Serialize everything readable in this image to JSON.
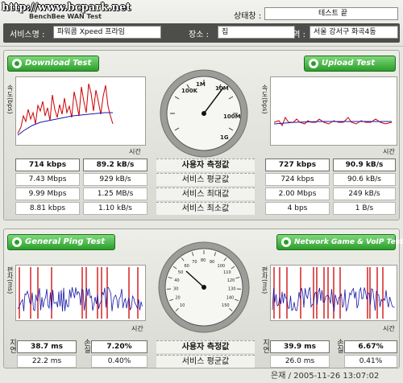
{
  "header": {
    "watermark": "http://www.bcpark.net",
    "brand": "BenchBee WAN Test",
    "status_label": "상태창 :",
    "status_value": "테스트 끝",
    "service_label": "서비스명 :",
    "service_value": "파워콤 Xpeed 프라임",
    "place_label": "장소 :",
    "place_value": "집",
    "region_label": "지역 :",
    "region_value": "서울 강서구 화곡4동"
  },
  "speed_section": {
    "download_button": "Download Test",
    "upload_button": "Upload Test",
    "y_axis_label": "속도(bps)",
    "x_axis_label": "시간",
    "gauge_ticks": [
      "100K",
      "1M",
      "10M",
      "100M",
      "1G"
    ],
    "row_labels": [
      "사용자 측정값",
      "서비스 평균값",
      "서비스 최대값",
      "서비스 최소값"
    ],
    "download_values": [
      [
        "714 kbps",
        "89.2 kB/s"
      ],
      [
        "7.43 Mbps",
        "929 kB/s"
      ],
      [
        "9.99 Mbps",
        "1.25 MB/s"
      ],
      [
        "8.81 kbps",
        "1.10 kB/s"
      ]
    ],
    "upload_values": [
      [
        "727 kbps",
        "90.9 kB/s"
      ],
      [
        "724 kbps",
        "90.6 kB/s"
      ],
      [
        "2.00 Mbps",
        "249 kB/s"
      ],
      [
        "4 bps",
        "1 B/s"
      ]
    ]
  },
  "ping_section": {
    "ping_button": "General Ping Test",
    "game_button": "Network Game & VoIP Test",
    "y_axis_label": "편차(ms)",
    "x_axis_label": "시간",
    "gauge_ticks": [
      "10",
      "20",
      "30",
      "40",
      "50",
      "60",
      "70",
      "80",
      "90",
      "100",
      "110",
      "120",
      "130",
      "140",
      "150"
    ],
    "side_label_delay": "지연",
    "side_label_loss": "손실",
    "row_labels": [
      "사용자 측정값",
      "서비스 평균값"
    ],
    "ping_values": [
      [
        "38.7 ms",
        "7.20%"
      ],
      [
        "22.2 ms",
        "0.40%"
      ]
    ],
    "game_values": [
      [
        "39.9 ms",
        "6.67%"
      ],
      [
        "26.0 ms",
        "0.41%"
      ]
    ]
  },
  "footer": {
    "text": "은재 / 2005-11-26 13:07:02"
  },
  "colors": {
    "green_button": "#2b9e2a",
    "dark_bar": "#4d4e4a",
    "series_red": "#cc0000",
    "series_blue": "#1a1aa8"
  }
}
